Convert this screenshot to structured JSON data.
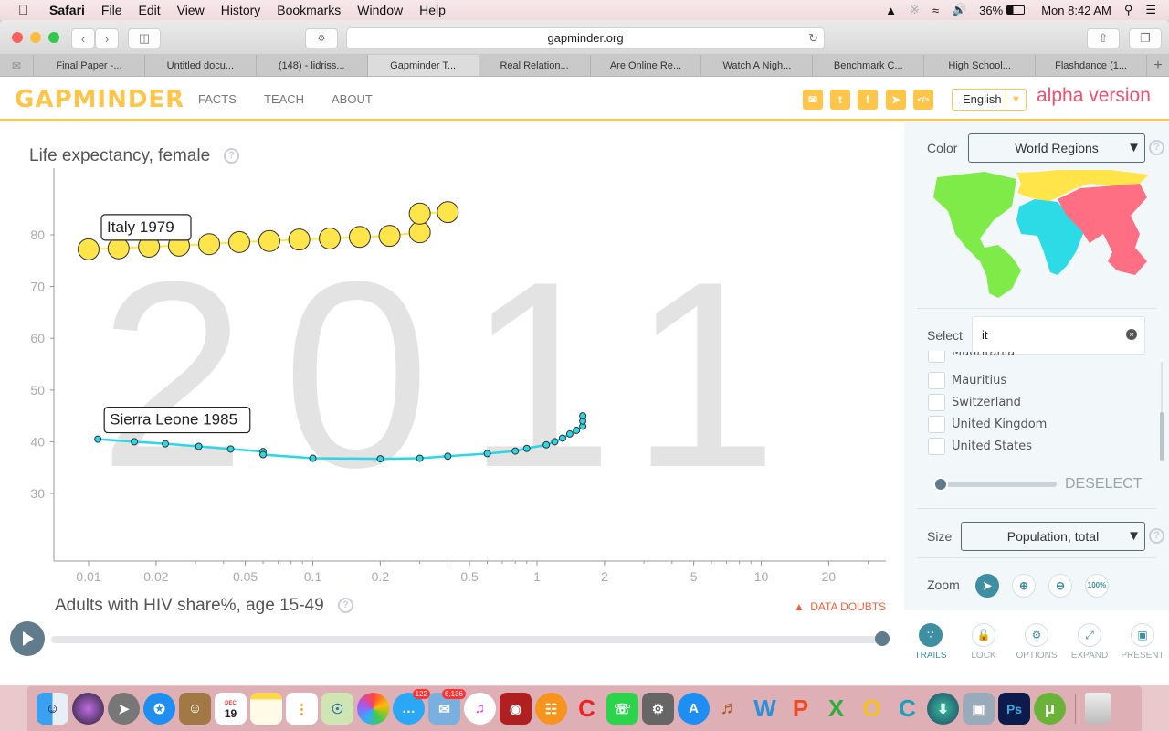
{
  "menubar": {
    "app": "Safari",
    "items": [
      "File",
      "Edit",
      "View",
      "History",
      "Bookmarks",
      "Window",
      "Help"
    ],
    "battery": "36%",
    "clock": "Mon 8:42 AM"
  },
  "browser": {
    "url": "gapminder.org",
    "tabs": [
      "Final Paper -...",
      "Untitled docu...",
      "(148) - lidriss...",
      "Gapminder T...",
      "Real Relation...",
      "Are Online Re...",
      "Watch A Nigh...",
      "Benchmark C...",
      "High School...",
      "Flashdance (1..."
    ],
    "active_tab": 3
  },
  "header": {
    "logo": "GAPMINDER",
    "nav": [
      "FACTS",
      "TEACH",
      "ABOUT"
    ],
    "share_icons": [
      "mail-icon",
      "twitter-icon",
      "facebook-icon",
      "telegram-icon",
      "embed-icon"
    ],
    "language": "English",
    "alpha_label": "alpha version"
  },
  "chart": {
    "y_title": "Life expectancy, female",
    "x_title": "Adults with HIV share%, age 15-49",
    "year_watermark": "2011",
    "data_doubts": "DATA DOUBTS",
    "play_label": "play",
    "timeslider_progress": 1.0
  },
  "chart_data": {
    "type": "scatter",
    "title": "",
    "xlabel": "Adults with HIV share%, age 15-49",
    "ylabel": "Life expectancy, female",
    "x_scale": "log",
    "xlim": [
      0.008,
      35
    ],
    "ylim": [
      20,
      90
    ],
    "x_ticks": [
      0.01,
      0.02,
      0.05,
      0.1,
      0.2,
      0.5,
      1,
      2,
      5,
      10,
      20
    ],
    "x_tick_labels": [
      "0.01",
      "0.02",
      "0.05",
      "0.1",
      "0.2",
      "0.5",
      "1",
      "2",
      "5",
      "10",
      "20"
    ],
    "y_ticks": [
      30,
      40,
      50,
      60,
      70,
      80
    ],
    "y_tick_labels": [
      "30",
      "40",
      "50",
      "60",
      "70",
      "80"
    ],
    "year": 2011,
    "series": [
      {
        "name": "Italy",
        "label": "Italy 1979",
        "color": "#ffe54a",
        "trail": true,
        "bubble": "large",
        "x": [
          0.01,
          0.0136,
          0.0186,
          0.0253,
          0.0345,
          0.047,
          0.064,
          0.087,
          0.119,
          0.162,
          0.22,
          0.3,
          0.3,
          0.4
        ],
        "y": [
          77.2,
          77.4,
          77.7,
          77.9,
          78.2,
          78.6,
          78.8,
          79.1,
          79.3,
          79.6,
          79.8,
          80.5,
          84.1,
          84.4
        ]
      },
      {
        "name": "Sierra Leone",
        "label": "Sierra Leone 1985",
        "color": "#2bd6e6",
        "trail": true,
        "bubble": "small",
        "x": [
          0.011,
          0.016,
          0.022,
          0.031,
          0.043,
          0.06,
          0.06,
          0.1,
          0.2,
          0.3,
          0.4,
          0.6,
          0.8,
          0.9,
          1.1,
          1.2,
          1.3,
          1.4,
          1.5,
          1.6,
          1.6,
          1.6
        ],
        "y": [
          40.5,
          40.0,
          39.6,
          39.1,
          38.6,
          38.1,
          37.5,
          36.8,
          36.7,
          36.8,
          37.2,
          37.7,
          38.2,
          38.7,
          39.4,
          40.0,
          40.7,
          41.5,
          42.2,
          43.0,
          44.0,
          45.0
        ]
      }
    ]
  },
  "sidebar": {
    "color_label": "Color",
    "color_value": "World Regions",
    "map_regions": [
      {
        "name": "americas",
        "color": "#7feb48"
      },
      {
        "name": "europe",
        "color": "#ffe54a"
      },
      {
        "name": "africa",
        "color": "#2ddbe7"
      },
      {
        "name": "asia",
        "color": "#ff6f83"
      }
    ],
    "select_label": "Select",
    "search_value": "it",
    "search_results": [
      "Mauritania",
      "Mauritius",
      "Switzerland",
      "United Kingdom",
      "United States"
    ],
    "opacity_slider": 0.0,
    "deselect_label": "DESELECT",
    "size_label": "Size",
    "size_value": "Population, total",
    "zoom_label": "Zoom",
    "zoom_buttons": [
      "pointer",
      "zoom-in",
      "zoom-out",
      "100%"
    ],
    "footer_buttons": [
      "TRAILS",
      "LOCK",
      "OPTIONS",
      "EXPAND",
      "PRESENT"
    ]
  },
  "dock": {
    "messages_badge": "122",
    "mail_badge": "6,136",
    "calendar_day": "19",
    "calendar_month": "DEC"
  }
}
